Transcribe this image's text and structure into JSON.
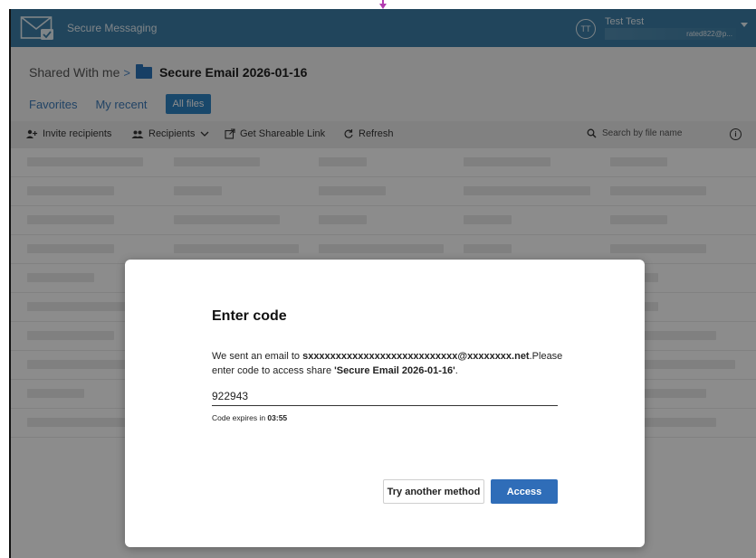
{
  "header": {
    "app_title": "Secure Messaging",
    "avatar_initials": "TT",
    "user_name": "Test Test",
    "user_email": "rated822@p..."
  },
  "breadcrumb": {
    "root": "Shared With me",
    "separator": ">",
    "current": "Secure Email 2026-01-16"
  },
  "tabs": [
    {
      "label": "Favorites"
    },
    {
      "label": "My recent"
    },
    {
      "label": "All files",
      "active": true
    }
  ],
  "toolbar": {
    "invite_label": "Invite recipients",
    "recipients_label": "Recipients",
    "shareable_link_label": "Get Shareable Link",
    "refresh_label": "Refresh",
    "search_placeholder": "Search by file name"
  },
  "modal": {
    "title": "Enter code",
    "message_prefix": "We sent an email to ",
    "masked_email": "sxxxxxxxxxxxxxxxxxxxxxxxxxxx@xxxxxxxx.net",
    "message_mid": ".Please enter code to access share ",
    "share_name": "'Secure Email 2026-01-16'",
    "message_suffix": ".",
    "code_value": "922943",
    "expires_prefix": "Code expires in ",
    "expires_time": "03:55",
    "try_another_label": "Try another method",
    "access_label": "Access"
  },
  "colors": {
    "header_bg": "#3c7fa8",
    "primary_button": "#2f6db8",
    "active_tab": "#2f83c4",
    "link": "#3d7bb8"
  }
}
